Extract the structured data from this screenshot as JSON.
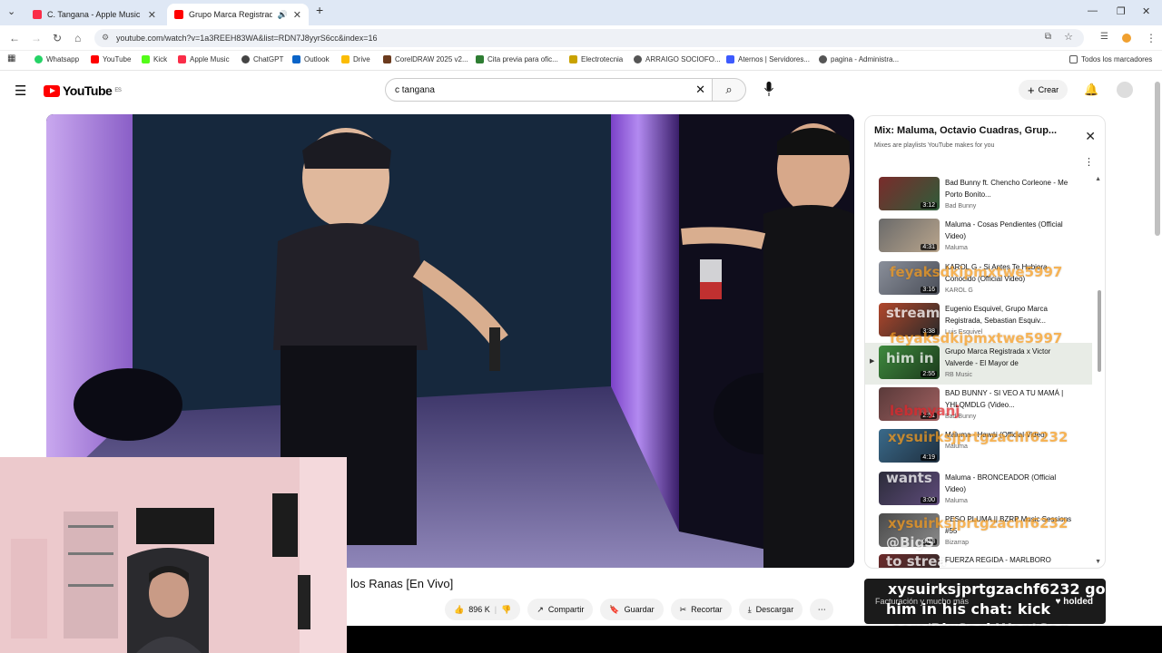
{
  "browser": {
    "tabs": [
      {
        "title": "C. Tangana - Apple Music",
        "active": false
      },
      {
        "title": "Grupo Marca Registrada x V",
        "active": true
      }
    ],
    "new_tab": "+",
    "url": "youtube.com/watch?v=1a3REEH83WA&list=RDN7J8yyrS6cc&index=16",
    "bookmarks": [
      "Whatsapp",
      "YouTube",
      "Kick",
      "Apple Music",
      "ChatGPT",
      "Outlook",
      "Drive",
      "CorelDRAW 2025 v2...",
      "Cita previa para ofic...",
      "Electrotecnia",
      "ARRAIGO SOCIOFO...",
      "Aternos | Servidores...",
      "pagina - Administra...",
      "Todos los marcadores"
    ]
  },
  "youtube": {
    "logo": "YouTube",
    "region": "ES",
    "search_value": "c tangana",
    "create_label": "Crear"
  },
  "video": {
    "title_visible": "los Ranas [En Vivo]",
    "likes": "896 K",
    "actions": {
      "share": "Compartir",
      "save": "Guardar",
      "clip": "Recortar",
      "download": "Descargar"
    }
  },
  "playlist": {
    "title": "Mix: Maluma, Octavio Cuadras, Grup...",
    "subtitle": "Mixes are playlists YouTube makes for you",
    "items": [
      {
        "title": "Bad Bunny ft. Chencho Corleone - Me Porto Bonito...",
        "channel": "Bad Bunny",
        "duration": "3:12"
      },
      {
        "title": "Maluma - Cosas Pendientes (Official Video)",
        "channel": "Maluma",
        "duration": "4:31"
      },
      {
        "title": "KAROL G - Si Antes Te Hubiera Conocido (Official Video)",
        "channel": "KAROL G",
        "duration": "3:16"
      },
      {
        "title": "Eugenio Esquivel, Grupo Marca Registrada, Sebastian Esquiv...",
        "channel": "Luis Esquivel",
        "duration": "3:38"
      },
      {
        "title": "Grupo Marca Registrada x Victor Valverde - El Mayor de",
        "channel": "RB Music",
        "duration": "2:55",
        "current": true
      },
      {
        "title": "BAD BUNNY - SI VEO A TU MAMÁ | YHLQMDLG (Video...",
        "channel": "Bad Bunny",
        "duration": "2:51"
      },
      {
        "title": "Maluma - Hawái (Official Video)",
        "channel": "Maluma",
        "duration": "4:19"
      },
      {
        "title": "Maluma - BRONCEADOR (Official Video)",
        "channel": "Maluma",
        "duration": "3:00"
      },
      {
        "title": "PESO PLUMA || BZRP Music Sessions #55",
        "channel": "Bizarrap",
        "duration": "3:18"
      },
      {
        "title": "FUERZA REGIDA - MARLBORO",
        "channel": "",
        "duration": ""
      }
    ]
  },
  "overlays": {
    "chat": [
      {
        "text": "feyaksdkipmxtwe5997",
        "color": "#f39a1e"
      },
      {
        "text": "feyaksdkipmxtwe5997",
        "color": "#f39a1e"
      },
      {
        "text": "xysuirksjprtgzachf6232",
        "color": "#f39a1e"
      },
      {
        "text": "xysuirksjprtgzachf6232",
        "color": "#f39a1e"
      },
      {
        "text": "stream",
        "color": "#ffffff"
      },
      {
        "text": "him in",
        "color": "#ffffff"
      },
      {
        "text": "lebmyanj",
        "color": "#e0262b"
      },
      {
        "text": "wants",
        "color": "#ffffff"
      },
      {
        "text": "@BigS",
        "color": "#ffffff"
      },
      {
        "text": "to strea",
        "color": "#ffffff"
      }
    ],
    "stream_box": {
      "line1": "xysuirksjprtgzachf6232 go",
      "line2": "him in his chat: kick",
      "line3": ".com/BigSackWontSag",
      "sponsor": "Facturación y mucho más",
      "brand": "holded"
    }
  }
}
